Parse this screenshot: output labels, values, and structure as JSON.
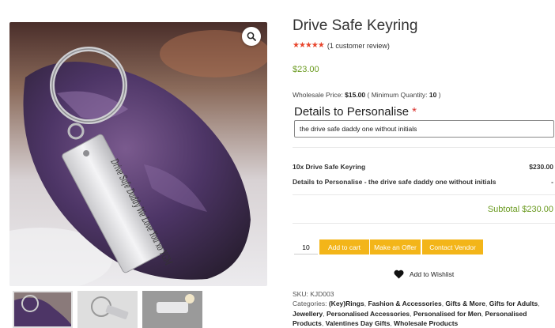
{
  "product": {
    "title": "Drive Safe Keyring",
    "stars": "★★★★★",
    "review_text": "(1 customer review)",
    "price": "$23.00",
    "wholesale_prefix": "Wholesale Price: ",
    "wholesale_price": "$15.00",
    "wholesale_min_prefix": " ( Minimum Quantity: ",
    "wholesale_min_qty": "10",
    "wholesale_suffix": " )",
    "keyring_engraving": "Drive Safe Daddy We Love You xo YGM"
  },
  "personalise": {
    "label": "Details to Personalise",
    "required_mark": "*",
    "value": "the drive safe daddy one without initials"
  },
  "order_summary": {
    "line1_label": "10x Drive Safe Keyring",
    "line1_amount": "$230.00",
    "line2_label": "Details to Personalise - the drive safe daddy one without initials",
    "line2_amount": "-",
    "subtotal": "Subtotal $230.00"
  },
  "actions": {
    "quantity": "10",
    "add_to_cart": "Add to cart",
    "make_offer": "Make an Offer",
    "contact_vendor": "Contact Vendor",
    "wishlist": "Add to Wishlist"
  },
  "meta": {
    "sku_label": "SKU: ",
    "sku": "KJD003",
    "categories_label": "Categories: ",
    "categories": [
      "(Key)Rings",
      "Fashion & Accessories",
      "Gifts & More",
      "Gifts for Adults",
      "Jewellery",
      "Personalised Accessories",
      "Personalised for Men",
      "Personalised Products",
      "Valentines Day Gifts",
      "Wholesale Products"
    ]
  },
  "colors": {
    "accent_button": "#f3b519",
    "price_green": "#6a9a1f",
    "star_red": "#e8452c"
  },
  "icons": [
    "zoom-icon",
    "heart-icon"
  ]
}
